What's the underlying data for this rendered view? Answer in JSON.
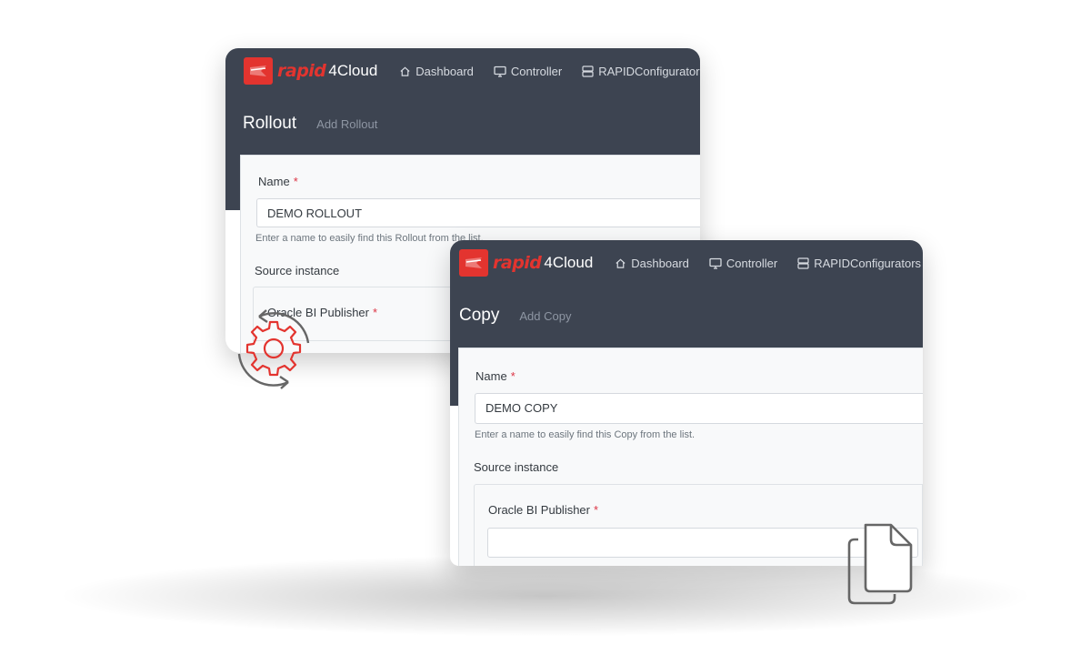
{
  "brand": {
    "rapid": "rapid",
    "cloud": "4Cloud",
    "color": "#e3342f"
  },
  "nav": {
    "dashboard": "Dashboard",
    "controller": "Controller",
    "configurators_rollout": "RAPIDConfigurators",
    "configurators_copy": "RAPIDConfigurators"
  },
  "rollout": {
    "title": "Rollout",
    "subtitle": "Add Rollout",
    "name_label": "Name",
    "required_mark": "*",
    "name_value": "DEMO ROLLOUT",
    "name_help": "Enter a name to easily find this Rollout from the list.",
    "source_title": "Source instance",
    "oracle_label": "Oracle BI Publisher"
  },
  "copy": {
    "title": "Copy",
    "subtitle": "Add Copy",
    "name_label": "Name",
    "required_mark": "*",
    "name_value": "DEMO COPY",
    "name_help": "Enter a name to easily find this Copy from the list.",
    "source_title": "Source instance",
    "oracle_label": "Oracle BI Publisher",
    "oracle_value": ""
  },
  "icons": {
    "nav": [
      "home-icon",
      "monitor-icon",
      "server-icon",
      "chevron-down-icon"
    ],
    "decorative": [
      "gear-sync-icon",
      "copy-documents-icon"
    ]
  },
  "colors": {
    "header": "#3d4451",
    "accent": "#e3342f",
    "required": "#dc3545",
    "panel": "#f8f9fa"
  }
}
